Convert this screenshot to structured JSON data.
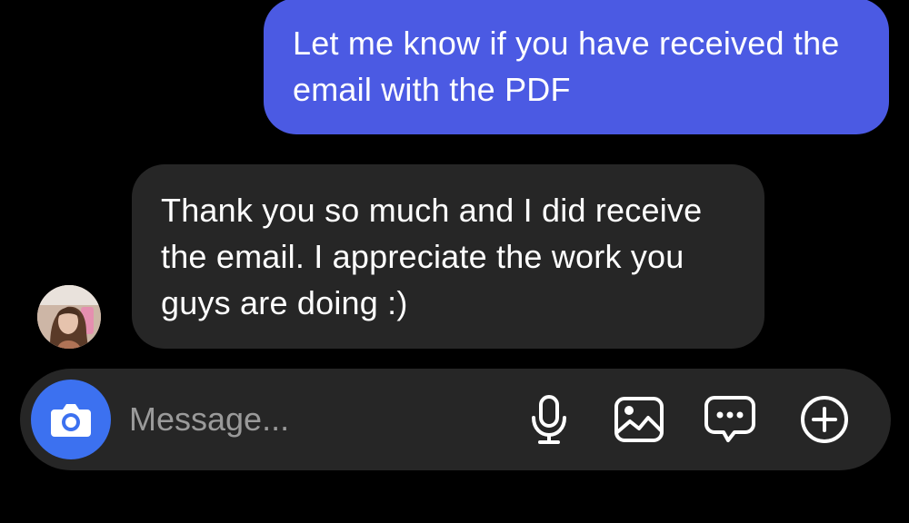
{
  "conversation": {
    "sent_message": {
      "text": "Let me know if you have received the email with the PDF",
      "color": "#4b5ae3"
    },
    "received_message": {
      "text": "Thank you so much and I did receive the email. I appreciate the work you guys are doing :)",
      "color": "#262626"
    }
  },
  "composer": {
    "placeholder": "Message...",
    "camera_color": "#3c71f0",
    "icons": [
      "camera-icon",
      "microphone-icon",
      "gallery-icon",
      "chat-bubble-icon",
      "add-icon"
    ]
  }
}
